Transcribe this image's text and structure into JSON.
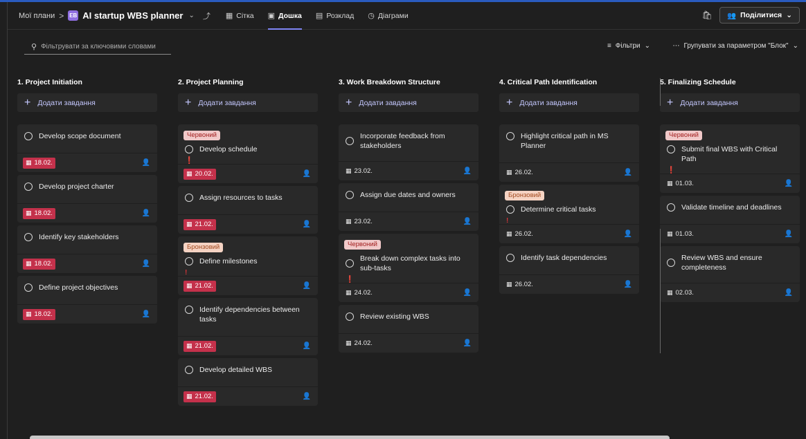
{
  "header": {
    "breadcrumb_root": "Мої плани",
    "breadcrumb_sep": ">",
    "plan_icon_text": "EB",
    "plan_title": "AI startup WBS planner",
    "views": [
      {
        "label": "Сітка",
        "icon": "grid-icon"
      },
      {
        "label": "Дошка",
        "icon": "board-icon",
        "active": true
      },
      {
        "label": "Розклад",
        "icon": "schedule-icon"
      },
      {
        "label": "Діаграми",
        "icon": "charts-icon"
      }
    ],
    "share_label": "Поділитися"
  },
  "toolbar": {
    "search_placeholder": "Фільтрувати за ключовими словами",
    "filters_label": "Фільтри",
    "groupby_label": "Групувати за параметром \"Блок\""
  },
  "add_task_label": "Додати завдання",
  "columns": [
    {
      "title": "1. Project Initiation",
      "cards": [
        {
          "title": "Develop scope document",
          "date": "18.02.",
          "late": true
        },
        {
          "title": "Develop project charter",
          "date": "18.02.",
          "late": true
        },
        {
          "title": "Identify key stakeholders",
          "date": "18.02.",
          "late": true
        },
        {
          "title": "Define project objectives",
          "date": "18.02.",
          "late": true
        }
      ]
    },
    {
      "title": "2. Project Planning",
      "cards": [
        {
          "label": "Червоний",
          "title": "Develop schedule",
          "priority": "urgent",
          "date": "20.02.",
          "late": true
        },
        {
          "title": "Assign resources to tasks",
          "date": "21.02.",
          "late": true
        },
        {
          "label": "Бронзовий",
          "title": "Define milestones",
          "priority": "important",
          "date": "21.02.",
          "late": true
        },
        {
          "title": "Identify dependencies between tasks",
          "date": "21.02.",
          "late": true
        },
        {
          "title": "Develop detailed WBS",
          "date": "21.02.",
          "late": true
        }
      ]
    },
    {
      "title": "3. Work Breakdown Structure",
      "cards": [
        {
          "title": "Incorporate feedback from stakeholders",
          "date": "23.02.",
          "late": false
        },
        {
          "title": "Assign due dates and owners",
          "date": "23.02.",
          "late": false
        },
        {
          "label": "Червоний",
          "title": "Break down complex tasks into sub-tasks",
          "priority": "urgent",
          "date": "24.02.",
          "late": false
        },
        {
          "title": "Review existing WBS",
          "date": "24.02.",
          "late": false
        }
      ]
    },
    {
      "title": "4. Critical Path Identification",
      "cards": [
        {
          "title": "Highlight critical path in MS Planner",
          "date": "26.02.",
          "late": false
        },
        {
          "label": "Бронзовий",
          "title": "Determine critical tasks",
          "priority": "important",
          "date": "26.02.",
          "late": false
        },
        {
          "title": "Identify task dependencies",
          "date": "26.02.",
          "late": false
        }
      ]
    },
    {
      "title": "5. Finalizing Schedule",
      "cards": [
        {
          "label": "Червоний",
          "title": "Submit final WBS with Critical Path",
          "priority": "urgent",
          "date": "01.03.",
          "late": false
        },
        {
          "title": "Validate timeline and deadlines",
          "date": "01.03.",
          "late": false
        },
        {
          "title": "Review WBS and ensure completeness",
          "date": "02.03.",
          "late": false
        }
      ]
    }
  ]
}
